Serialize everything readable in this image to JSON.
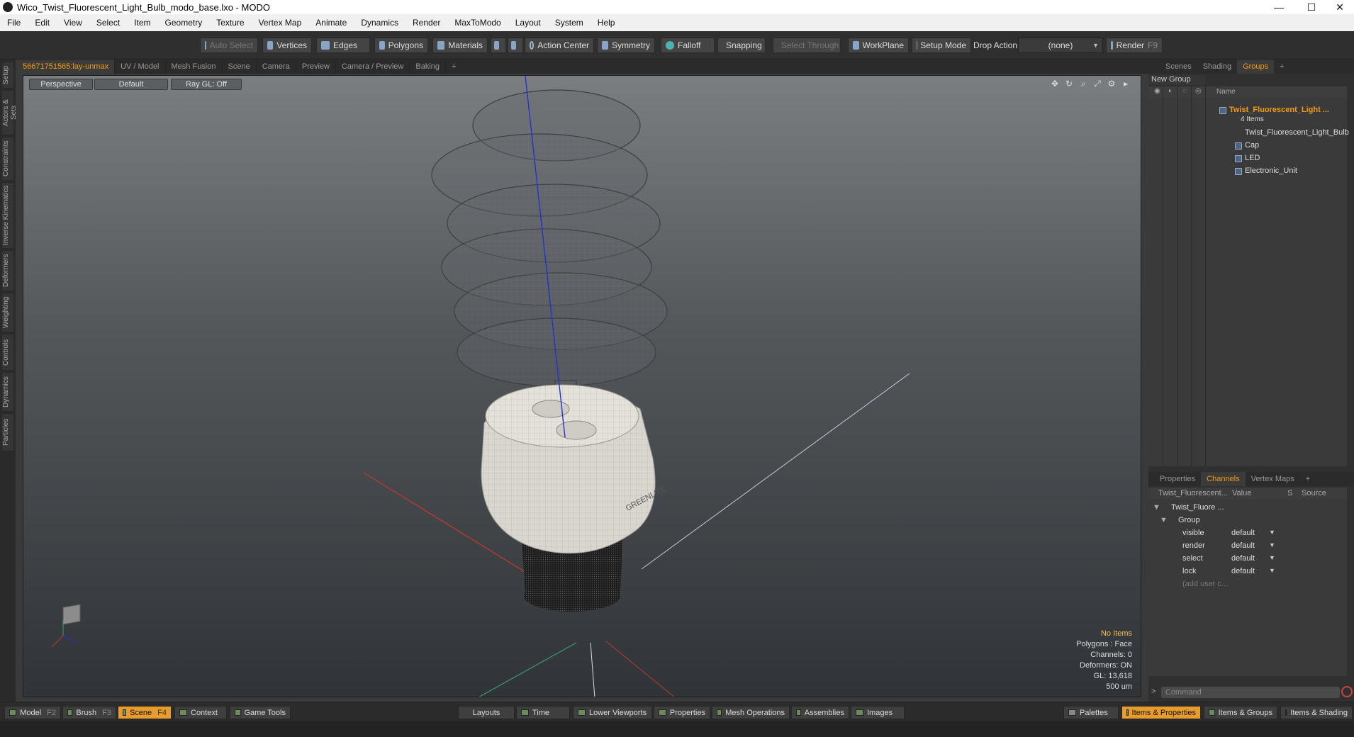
{
  "window": {
    "title": "Wico_Twist_Fluorescent_Light_Bulb_modo_base.lxo - MODO",
    "minimize": "—",
    "maximize": "☐",
    "close": "✕"
  },
  "menu": [
    "File",
    "Edit",
    "View",
    "Select",
    "Item",
    "Geometry",
    "Texture",
    "Vertex Map",
    "Animate",
    "Dynamics",
    "Render",
    "MaxToModo",
    "Layout",
    "System",
    "Help"
  ],
  "toolbar": {
    "auto_select": "Auto Select",
    "vertices": "Vertices",
    "edges": "Edges",
    "polygons": "Polygons",
    "materials": "Materials",
    "action_center": "Action Center",
    "symmetry": "Symmetry",
    "falloff": "Falloff",
    "snapping": "Snapping",
    "select_through": "Select Through",
    "workplane": "WorkPlane",
    "setup_mode": "Setup Mode",
    "drop_action_label": "Drop Action",
    "drop_action_value": "(none)",
    "render": "Render",
    "render_key": "F9"
  },
  "left_tabs": [
    "Setup",
    "Actors & Sets",
    "Constraints",
    "Inverse Kinematics",
    "Deformers",
    "Weighting",
    "Controls",
    "Dynamics",
    "Particles"
  ],
  "viewport_tabs": [
    "56671751565:lay-unmax",
    "UV / Model",
    "Mesh Fusion",
    "Scene",
    "Camera",
    "Preview",
    "Camera / Preview",
    "Baking"
  ],
  "viewport": {
    "view": "Perspective",
    "shading": "Default",
    "raygl": "Ray GL: Off",
    "info": {
      "selection": "No Items",
      "polygons": "Polygons : Face",
      "channels": "Channels: 0",
      "deformers": "Deformers: ON",
      "gl": "GL: 13,618",
      "scale": "500 um"
    },
    "label_text": "GREENLITE"
  },
  "scene_tabs": [
    "Scenes",
    "Shading",
    "Groups"
  ],
  "groups": {
    "new_group": "New Group",
    "name_header": "Name",
    "group_name": "Twist_Fluorescent_Light ...",
    "group_count": "4 Items",
    "items": [
      "Twist_Fluorescent_Light_Bulb",
      "Cap",
      "LED",
      "Electronic_Unit"
    ]
  },
  "prop_tabs": [
    "Properties",
    "Channels",
    "Vertex Maps"
  ],
  "channels": {
    "headers": {
      "name": "Twist_Fluorescent...",
      "value": "Value",
      "s": "S",
      "source": "Source"
    },
    "root": "Twist_Fluore ...",
    "group": "Group",
    "rows": [
      {
        "name": "visible",
        "value": "default"
      },
      {
        "name": "render",
        "value": "default"
      },
      {
        "name": "select",
        "value": "default"
      },
      {
        "name": "lock",
        "value": "default"
      }
    ],
    "add_user": "(add user c..."
  },
  "command": {
    "placeholder": "Command"
  },
  "bottom_left": [
    {
      "label": "Model",
      "key": "F2"
    },
    {
      "label": "Brush",
      "key": "F3"
    },
    {
      "label": "Scene",
      "key": "F4"
    },
    {
      "label": "Context",
      "key": ""
    },
    {
      "label": "Game Tools",
      "key": ""
    }
  ],
  "bottom_mid": [
    "Layouts",
    "Time",
    "Lower Viewports",
    "Properties",
    "Mesh Operations",
    "Assemblies",
    "Images"
  ],
  "bottom_right": [
    "Palettes",
    "Items & Properties",
    "Items & Groups",
    "Items & Shading"
  ],
  "colors": {
    "accent": "#f39c12",
    "active_button": "#e89c2c"
  }
}
